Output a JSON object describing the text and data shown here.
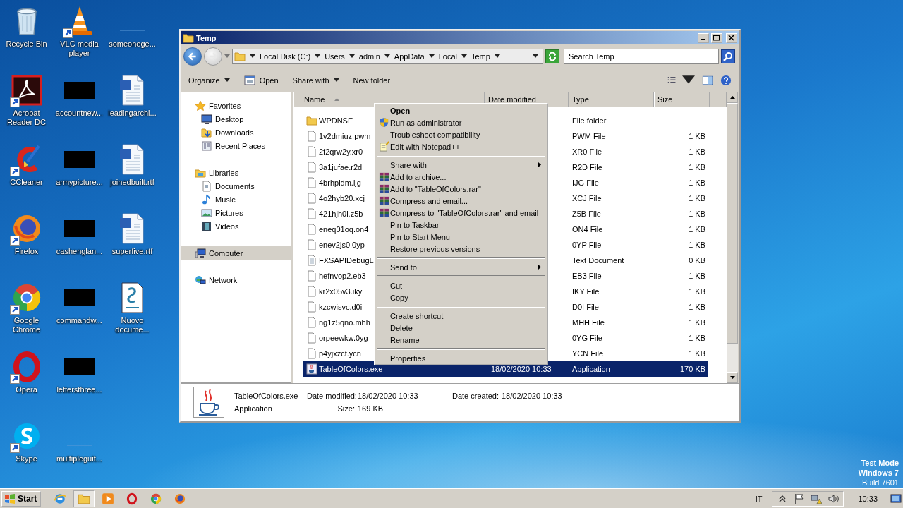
{
  "desktop": {
    "icons": [
      {
        "label": "Recycle Bin",
        "kind": "recycle",
        "shortcut": false
      },
      {
        "label": "Acrobat Reader DC",
        "kind": "acrobat",
        "shortcut": true
      },
      {
        "label": "CCleaner",
        "kind": "ccleaner",
        "shortcut": true
      },
      {
        "label": "Firefox",
        "kind": "firefox",
        "shortcut": true
      },
      {
        "label": "Google Chrome",
        "kind": "chrome",
        "shortcut": true
      },
      {
        "label": "Opera",
        "kind": "opera",
        "shortcut": true
      },
      {
        "label": "Skype",
        "kind": "skype",
        "shortcut": true
      },
      {
        "label": "VLC media player",
        "kind": "vlc",
        "shortcut": true
      },
      {
        "label": "accountnew...",
        "kind": "thumb",
        "shortcut": false
      },
      {
        "label": "armypicture...",
        "kind": "thumb",
        "shortcut": false
      },
      {
        "label": "cashenglan...",
        "kind": "thumb",
        "shortcut": false
      },
      {
        "label": "commandw...",
        "kind": "thumb",
        "shortcut": false
      },
      {
        "label": "lettersthree...",
        "kind": "thumb",
        "shortcut": false
      },
      {
        "label": "multipleguit...",
        "kind": "blank",
        "shortcut": false
      },
      {
        "label": "someonege...",
        "kind": "blank",
        "shortcut": false
      },
      {
        "label": "leadingarchi...",
        "kind": "word",
        "shortcut": false
      },
      {
        "label": "joinedbuilt.rtf",
        "kind": "word",
        "shortcut": false
      },
      {
        "label": "superfive.rtf",
        "kind": "word",
        "shortcut": false
      },
      {
        "label": "Nuovo docume...",
        "kind": "script",
        "shortcut": false
      }
    ],
    "notice": [
      "Test Mode",
      "Windows 7",
      "Build 7601"
    ]
  },
  "explorer": {
    "title": "Temp",
    "breadcrumbs": [
      "Local Disk (C:)",
      "Users",
      "admin",
      "AppData",
      "Local",
      "Temp"
    ],
    "search": {
      "placeholder": "Search Temp"
    },
    "toolbar": [
      {
        "label": "Organize",
        "kind": "menu"
      },
      {
        "label": "Open",
        "kind": "open"
      },
      {
        "label": "Share with",
        "kind": "menu"
      },
      {
        "label": "New folder",
        "kind": "plain"
      }
    ],
    "nav": [
      {
        "label": "Favorites",
        "kind": "star",
        "selected": false,
        "children": [
          {
            "label": "Desktop",
            "kind": "monitor",
            "selected": false
          },
          {
            "label": "Downloads",
            "kind": "downloads",
            "selected": false
          },
          {
            "label": "Recent Places",
            "kind": "recent",
            "selected": false
          }
        ]
      },
      {
        "label": "Libraries",
        "kind": "library",
        "selected": false,
        "children": [
          {
            "label": "Documents",
            "kind": "document",
            "selected": false
          },
          {
            "label": "Music",
            "kind": "music",
            "selected": false
          },
          {
            "label": "Pictures",
            "kind": "pictures",
            "selected": false
          },
          {
            "label": "Videos",
            "kind": "videos",
            "selected": false
          }
        ]
      },
      {
        "label": "Computer",
        "kind": "computer",
        "selected": true
      },
      {
        "label": "Network",
        "kind": "network",
        "selected": false
      }
    ],
    "columns": [
      {
        "label": "Name",
        "sorted": true
      },
      {
        "label": "Date modified",
        "sorted": false
      },
      {
        "label": "Type",
        "sorted": false
      },
      {
        "label": "Size",
        "sorted": false
      }
    ],
    "files": [
      {
        "name": "WPDNSE",
        "kind": "folder",
        "type": "File folder",
        "selected": false
      },
      {
        "name": "1v2dmiuz.pwm",
        "kind": "file",
        "type": "PWM File",
        "size": "1 KB",
        "selected": false
      },
      {
        "name": "2f2qrw2y.xr0",
        "kind": "file",
        "type": "XR0 File",
        "size": "1 KB",
        "selected": false
      },
      {
        "name": "3a1jufae.r2d",
        "kind": "file",
        "type": "R2D File",
        "size": "1 KB",
        "selected": false
      },
      {
        "name": "4brhpidm.ijg",
        "kind": "file",
        "type": "IJG File",
        "size": "1 KB",
        "selected": false
      },
      {
        "name": "4o2hyb20.xcj",
        "kind": "file",
        "type": "XCJ File",
        "size": "1 KB",
        "selected": false
      },
      {
        "name": "421hjh0i.z5b",
        "kind": "file",
        "type": "Z5B File",
        "size": "1 KB",
        "selected": false
      },
      {
        "name": "eneq01oq.on4",
        "kind": "file",
        "type": "ON4 File",
        "size": "1 KB",
        "selected": false
      },
      {
        "name": "enev2js0.0yp",
        "kind": "file",
        "type": "0YP File",
        "size": "1 KB",
        "selected": false
      },
      {
        "name": "FXSAPIDebugL",
        "kind": "text",
        "type": "Text Document",
        "size": "0 KB",
        "selected": false
      },
      {
        "name": "hefnvop2.eb3",
        "kind": "file",
        "type": "EB3 File",
        "size": "1 KB",
        "selected": false
      },
      {
        "name": "kr2x05v3.iky",
        "kind": "file",
        "type": "IKY File",
        "size": "1 KB",
        "selected": false
      },
      {
        "name": "kzcwisvc.d0i",
        "kind": "file",
        "type": "D0I File",
        "size": "1 KB",
        "selected": false
      },
      {
        "name": "ng1z5qno.mhh",
        "kind": "file",
        "type": "MHH File",
        "size": "1 KB",
        "selected": false
      },
      {
        "name": "orpeewkw.0yg",
        "kind": "file",
        "type": "0YG File",
        "size": "1 KB",
        "selected": false
      },
      {
        "name": "p4yjxzct.ycn",
        "kind": "file",
        "type": "YCN File",
        "size": "1 KB",
        "selected": false
      },
      {
        "name": "TableOfColors.exe",
        "kind": "app",
        "date": "18/02/2020 10:33",
        "type": "Application",
        "size": "170 KB",
        "selected": true
      }
    ],
    "details": {
      "name": "TableOfColors.exe",
      "type": "Application",
      "fields": [
        {
          "label": "Date modified:",
          "value": "18/02/2020 10:33"
        },
        {
          "label": "Size:",
          "value": "169 KB"
        },
        {
          "label": "Date created:",
          "value": "18/02/2020 10:33"
        }
      ]
    }
  },
  "context_menu": {
    "items": [
      {
        "kind": "default",
        "label": "Open"
      },
      {
        "kind": "admin",
        "label": "Run as administrator"
      },
      {
        "kind": "item",
        "label": "Troubleshoot compatibility"
      },
      {
        "kind": "editor",
        "label": "Edit with Notepad++"
      },
      {
        "kind": "separator"
      },
      {
        "kind": "submenu",
        "label": "Share with"
      },
      {
        "kind": "archive",
        "label": "Add to archive..."
      },
      {
        "kind": "archive",
        "label": "Add to \"TableOfColors.rar\""
      },
      {
        "kind": "archive",
        "label": "Compress and email..."
      },
      {
        "kind": "archive",
        "label": "Compress to \"TableOfColors.rar\" and email"
      },
      {
        "kind": "item",
        "label": "Pin to Taskbar"
      },
      {
        "kind": "item",
        "label": "Pin to Start Menu"
      },
      {
        "kind": "item",
        "label": "Restore previous versions"
      },
      {
        "kind": "separator"
      },
      {
        "kind": "submenu",
        "label": "Send to"
      },
      {
        "kind": "separator"
      },
      {
        "kind": "item",
        "label": "Cut"
      },
      {
        "kind": "item",
        "label": "Copy"
      },
      {
        "kind": "separator"
      },
      {
        "kind": "item",
        "label": "Create shortcut"
      },
      {
        "kind": "item",
        "label": "Delete"
      },
      {
        "kind": "item",
        "label": "Rename"
      },
      {
        "kind": "separator"
      },
      {
        "kind": "item",
        "label": "Properties"
      }
    ]
  },
  "taskbar": {
    "start": "Start",
    "apps": [
      {
        "kind": "ie",
        "selected": false
      },
      {
        "kind": "folder",
        "selected": true
      },
      {
        "kind": "media",
        "selected": false
      },
      {
        "kind": "opera",
        "selected": false
      },
      {
        "kind": "chrome",
        "selected": false
      },
      {
        "kind": "firefox",
        "selected": false
      }
    ],
    "language": "IT",
    "clock": "10:33"
  }
}
